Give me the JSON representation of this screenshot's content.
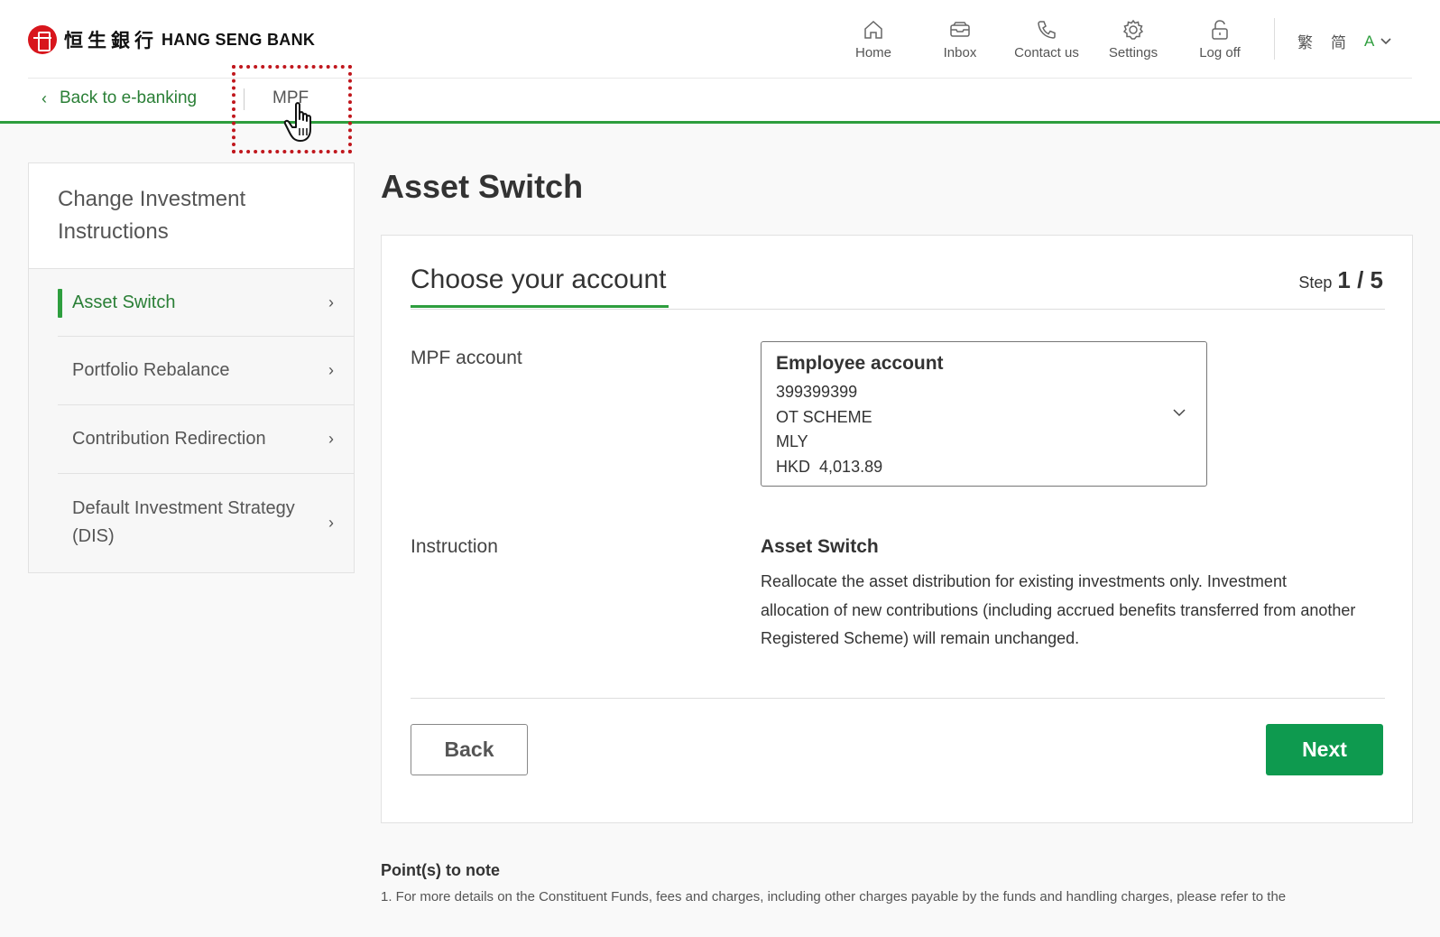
{
  "brand": {
    "name_cn": "恒生銀行",
    "name_en": "HANG SENG BANK",
    "color": "#d8161d"
  },
  "topnav": {
    "items": [
      {
        "label": "Home",
        "icon": "home-icon"
      },
      {
        "label": "Inbox",
        "icon": "inbox-icon"
      },
      {
        "label": "Contact us",
        "icon": "phone-icon"
      },
      {
        "label": "Settings",
        "icon": "gear-icon"
      },
      {
        "label": "Log off",
        "icon": "unlock-icon"
      }
    ],
    "lang_traditional": "繁",
    "lang_simplified": "简",
    "font_size": "A"
  },
  "subnav": {
    "back_label": "Back to e-banking",
    "current": "MPF"
  },
  "sidebar": {
    "heading": "Change Investment Instructions",
    "items": [
      {
        "label": "Asset Switch",
        "active": true
      },
      {
        "label": "Portfolio Rebalance",
        "active": false
      },
      {
        "label": "Contribution Redirection",
        "active": false
      },
      {
        "label": "Default Investment Strategy (DIS)",
        "active": false
      }
    ]
  },
  "main": {
    "page_title": "Asset Switch",
    "card_title": "Choose your account",
    "step_label": "Step",
    "step_value": "1 / 5",
    "mpf_account_label": "MPF account",
    "account": {
      "name": "Employee account",
      "number": "399399399",
      "scheme": "OT SCHEME",
      "type": "MLY",
      "currency": "HKD",
      "balance": "4,013.89"
    },
    "instruction_label": "Instruction",
    "instruction_title": "Asset Switch",
    "instruction_desc": "Reallocate the asset distribution for existing investments only. Investment allocation of new contributions (including accrued benefits transferred from another Registered Scheme) will remain unchanged.",
    "back_button": "Back",
    "next_button": "Next"
  },
  "notes": {
    "title": "Point(s) to note",
    "items": [
      "1.   For more details on the Constituent Funds, fees and charges, including other charges payable by the funds and handling charges, please refer to the"
    ]
  },
  "colors": {
    "accent_green": "#2e9e3e",
    "button_green": "#0e9a4f",
    "highlight_red": "#c0171d"
  }
}
